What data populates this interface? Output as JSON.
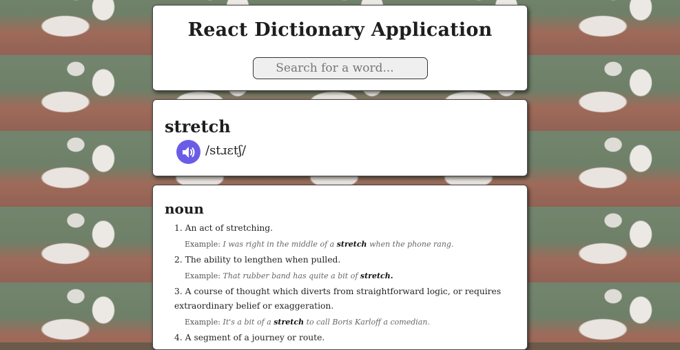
{
  "header": {
    "title": "React Dictionary Application",
    "search_placeholder": "Search for a word..."
  },
  "entry": {
    "word": "stretch",
    "phonetic": "/stɹɛtʃ/",
    "audio_icon": "speaker-icon"
  },
  "meaning": {
    "part_of_speech": "noun",
    "definitions": [
      {
        "number": "1.",
        "text": "An act of stretching.",
        "example_label": "Example:",
        "example_before": "I was right in the middle of a",
        "example_word": "stretch",
        "example_after": "when the phone rang."
      },
      {
        "number": "2.",
        "text": "The ability to lengthen when pulled.",
        "example_label": "Example:",
        "example_before": "That rubber band has quite a bit of",
        "example_word": "stretch.",
        "example_after": ""
      },
      {
        "number": "3.",
        "text": "A course of thought which diverts from straightforward logic, or requires extraordinary belief or exaggeration.",
        "example_label": "Example:",
        "example_before": "It's a bit of a",
        "example_word": "stretch",
        "example_after": "to call Boris Karloff a comedian."
      },
      {
        "number": "4.",
        "text": "A segment of a journey or route."
      }
    ]
  },
  "colors": {
    "audio_button": "#6b5ce7",
    "card_background": "#ffffff",
    "card_border": "#444444"
  }
}
